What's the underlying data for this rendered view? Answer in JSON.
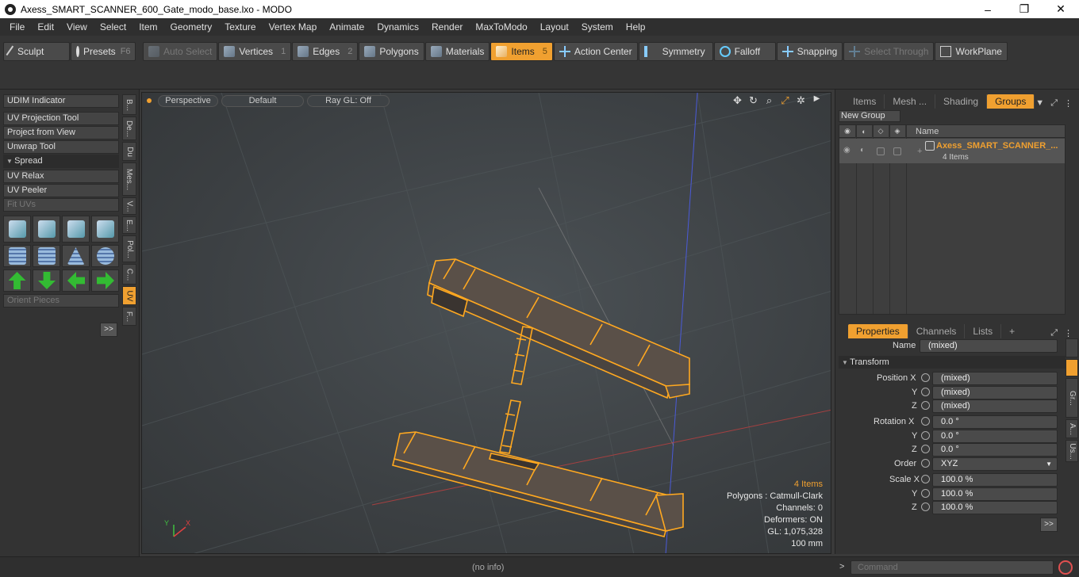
{
  "window": {
    "title": "Axess_SMART_SCANNER_600_Gate_modo_base.lxo - MODO",
    "minimize": "–",
    "maximize": "❐",
    "close": "✕"
  },
  "menu": [
    "File",
    "Edit",
    "View",
    "Select",
    "Item",
    "Geometry",
    "Texture",
    "Vertex Map",
    "Animate",
    "Dynamics",
    "Render",
    "MaxToModo",
    "Layout",
    "System",
    "Help"
  ],
  "toolbar": {
    "sculpt": "Sculpt",
    "presets": "Presets",
    "presets_key": "F6",
    "auto_select": "Auto Select",
    "vertices": "Vertices",
    "vertices_key": "1",
    "edges": "Edges",
    "edges_key": "2",
    "polygons": "Polygons",
    "materials": "Materials",
    "items": "Items",
    "items_key": "5",
    "action_center": "Action Center",
    "symmetry": "Symmetry",
    "falloff": "Falloff",
    "snapping": "Snapping",
    "select_through": "Select Through",
    "workplane": "WorkPlane"
  },
  "left_panel": {
    "udim": "UDIM Indicator",
    "uv_projection": "UV Projection Tool",
    "project_from_view": "Project from View",
    "unwrap": "Unwrap Tool",
    "spread": "Spread",
    "uv_relax": "UV Relax",
    "uv_peeler": "UV Peeler",
    "fit_uvs": "Fit UVs",
    "orient_pieces": "Orient Pieces",
    "expand": ">>",
    "vtabs": [
      "B...",
      "De...",
      "Du",
      "Mes...",
      "V...",
      "E...",
      "Pol...",
      "C...",
      "UV",
      "F..."
    ]
  },
  "viewport": {
    "view": "Perspective",
    "shading": "Default",
    "raygl": "Ray GL: Off",
    "stats": {
      "items": "4 Items",
      "polygons": "Polygons : Catmull-Clark",
      "channels": "Channels: 0",
      "deformers": "Deformers: ON",
      "gl": "GL: 1,075,328",
      "scale": "100 mm"
    },
    "axis_labels": {
      "y": "Y",
      "x": "X",
      "z": "Z"
    }
  },
  "groups_panel": {
    "tabs": [
      "Items",
      "Mesh ...",
      "Shading",
      "Groups"
    ],
    "new_group": "New Group",
    "name_header": "Name",
    "group_name": "Axess_SMART_SCANNER_...",
    "group_count": "4 Items"
  },
  "properties_panel": {
    "tabs": [
      "Properties",
      "Channels",
      "Lists"
    ],
    "add_tab": "+",
    "name_label": "Name",
    "name_value": "(mixed)",
    "transform": "Transform",
    "position_x_label": "Position X",
    "y_label": "Y",
    "z_label": "Z",
    "position_x": "(mixed)",
    "position_y": "(mixed)",
    "position_z": "(mixed)",
    "rotation_x_label": "Rotation X",
    "rotation_x": "0.0 °",
    "rotation_y": "0.0 °",
    "rotation_z": "0.0 °",
    "order_label": "Order",
    "order_value": "XYZ",
    "scale_x_label": "Scale X",
    "scale_x": "100.0 %",
    "scale_y": "100.0 %",
    "scale_z": "100.0 %",
    "expand": ">>",
    "vtabs": [
      "Gr...",
      "A...",
      "Us..."
    ]
  },
  "statusbar": {
    "info": "(no info)",
    "arrow": ">",
    "command_placeholder": "Command"
  },
  "colors": {
    "accent": "#f0a030",
    "wire": "#ffa820"
  }
}
